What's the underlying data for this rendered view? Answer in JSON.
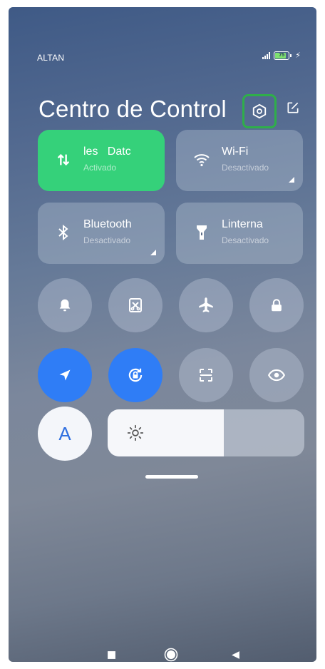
{
  "status_bar": {
    "carrier": "ALTAN",
    "battery_level": "75"
  },
  "header": {
    "title": "Centro de Control",
    "settings_icon": "gear-hexagon-icon",
    "edit_icon": "edit-icon"
  },
  "tiles": [
    {
      "name": "les   Datc",
      "state": "Activado",
      "icon": "mobile-data-icon",
      "active": true
    },
    {
      "name": "Wi-Fi",
      "state": "Desactivado",
      "icon": "wifi-icon",
      "active": false
    },
    {
      "name": "Bluetooth",
      "state": "Desactivado",
      "icon": "bluetooth-icon",
      "active": false
    },
    {
      "name": "Linterna",
      "state": "Desactivado",
      "icon": "flashlight-icon",
      "active": false
    }
  ],
  "toggles_row1": [
    "bell-icon",
    "screenshot-icon",
    "airplane-icon",
    "lock-icon"
  ],
  "toggles_row2": [
    "location-icon",
    "rotation-lock-icon",
    "scanner-icon",
    "eye-icon"
  ],
  "auto_brightness": {
    "label": "A",
    "icon": "auto-brightness-icon"
  },
  "brightness": {
    "level": 0.59,
    "icon": "sun-icon"
  },
  "nav_bar": [
    "recents-icon",
    "home-icon",
    "back-icon"
  ],
  "colors": {
    "active_green": "#35d17a",
    "active_blue": "#2f7df6",
    "highlight_green": "#2fae4a"
  }
}
